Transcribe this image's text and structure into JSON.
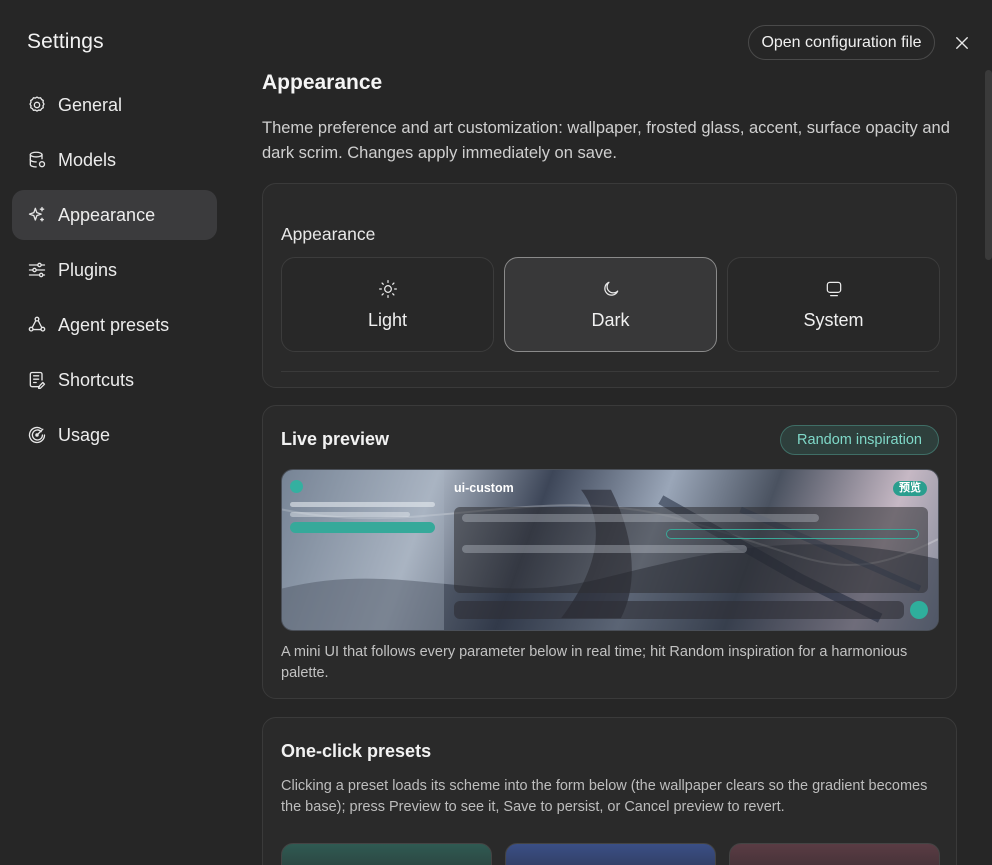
{
  "sidebar": {
    "title": "Settings",
    "items": [
      {
        "label": "General",
        "icon": "gear-icon"
      },
      {
        "label": "Models",
        "icon": "database-icon"
      },
      {
        "label": "Appearance",
        "icon": "sparkles-icon",
        "active": true
      },
      {
        "label": "Plugins",
        "icon": "sliders-icon"
      },
      {
        "label": "Agent presets",
        "icon": "agents-icon"
      },
      {
        "label": "Shortcuts",
        "icon": "notepad-icon"
      },
      {
        "label": "Usage",
        "icon": "gauge-icon"
      }
    ]
  },
  "header": {
    "open_config_label": "Open configuration file",
    "close_icon": "close-icon"
  },
  "main": {
    "title": "Appearance",
    "description": "Theme preference and art customization: wallpaper, frosted glass, accent, surface opacity and dark scrim. Changes apply immediately on save.",
    "theme_card": {
      "label": "Appearance",
      "options": [
        {
          "label": "Light",
          "icon": "sun-icon"
        },
        {
          "label": "Dark",
          "icon": "moon-icon",
          "selected": true
        },
        {
          "label": "System",
          "icon": "monitor-icon"
        }
      ]
    },
    "live_preview": {
      "title": "Live preview",
      "random_label": "Random inspiration",
      "preview_title": "ui-custom",
      "preview_badge": "预览",
      "caption": "A mini UI that follows every parameter below in real time; hit Random inspiration for a harmonious palette."
    },
    "presets": {
      "title": "One-click presets",
      "description": "Clicking a preset loads its scheme into the form below (the wallpaper clears so the gradient becomes the base); press Preview to see it, Save to persist, or Cancel preview to revert."
    }
  },
  "colors": {
    "background": "#262626",
    "accent": "#36a99a",
    "active_nav": "#3b3b3d"
  }
}
